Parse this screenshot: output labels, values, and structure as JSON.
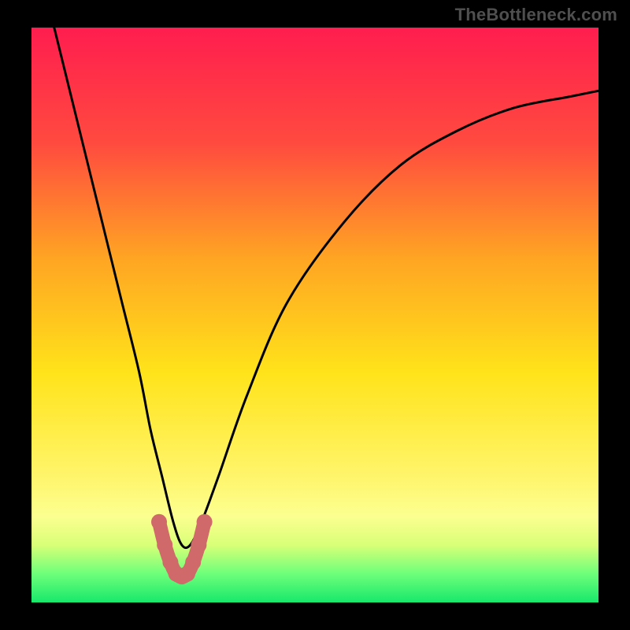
{
  "watermark": "TheBottleneck.com",
  "chart_data": {
    "type": "line",
    "title": "",
    "xlabel": "",
    "ylabel": "",
    "xlim": [
      0,
      100
    ],
    "ylim": [
      0,
      100
    ],
    "grid": false,
    "legend": false,
    "gradient_stops": [
      {
        "offset": 0,
        "color": "#ff1d4f"
      },
      {
        "offset": 20,
        "color": "#ff4a3f"
      },
      {
        "offset": 40,
        "color": "#ffa423"
      },
      {
        "offset": 60,
        "color": "#ffe31a"
      },
      {
        "offset": 78,
        "color": "#fff56b"
      },
      {
        "offset": 85,
        "color": "#fcff90"
      },
      {
        "offset": 90,
        "color": "#d9ff77"
      },
      {
        "offset": 95,
        "color": "#6eff7a"
      },
      {
        "offset": 100,
        "color": "#17e86b"
      }
    ],
    "series": [
      {
        "name": "bottleneck-curve",
        "color": "#000000",
        "x": [
          4,
          7,
          10,
          13,
          16,
          19,
          21,
          23,
          25,
          26.5,
          28,
          30,
          33,
          38,
          45,
          55,
          65,
          75,
          85,
          95,
          100
        ],
        "values": [
          100,
          88,
          76,
          64,
          52,
          40,
          30,
          22,
          14,
          10,
          10,
          14,
          22,
          36,
          52,
          66,
          76,
          82,
          86,
          88,
          89
        ]
      },
      {
        "name": "optimal-marker",
        "color": "#d06a6a",
        "x": [
          22.5,
          23.5,
          24.5,
          25.5,
          26.5,
          27.5,
          28.5,
          29.5,
          30.5
        ],
        "values": [
          14,
          10,
          7,
          5,
          4.5,
          5,
          7,
          10,
          14
        ]
      }
    ]
  }
}
